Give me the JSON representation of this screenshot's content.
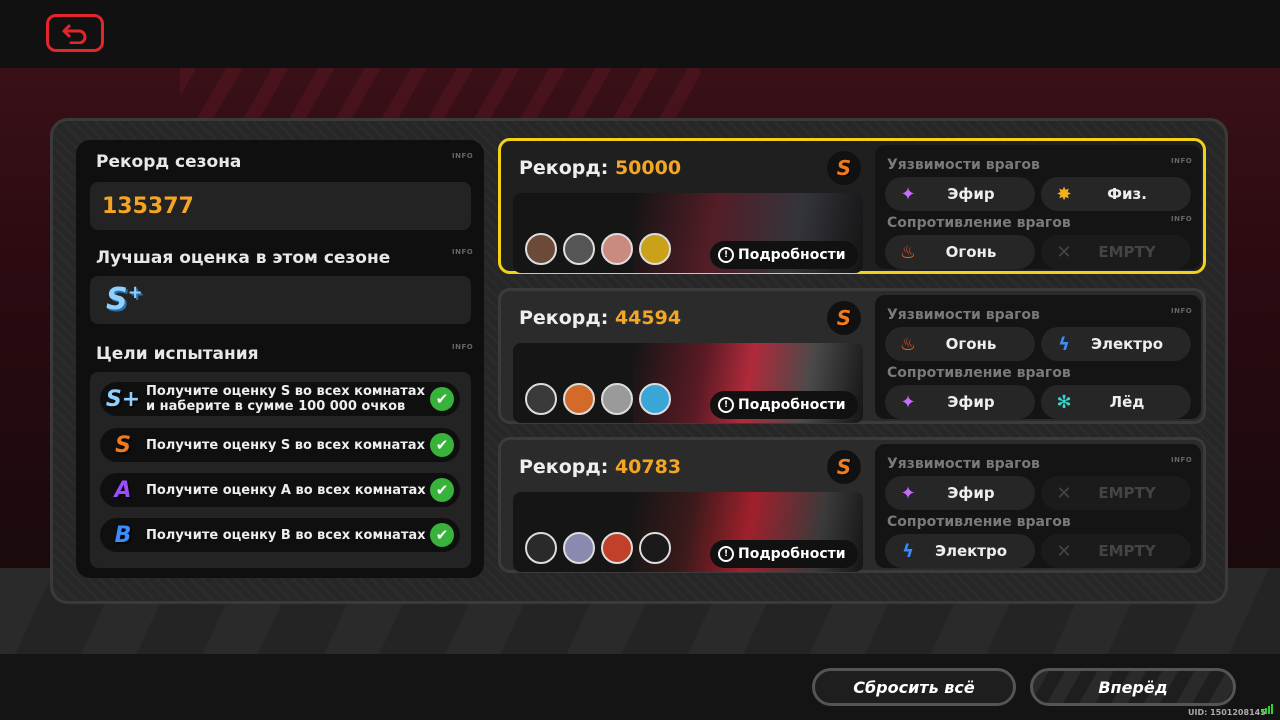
{
  "colors": {
    "accent": "#f5a524",
    "active_border": "#f2d11b",
    "back": "#e3262b",
    "check": "#37b23a"
  },
  "left": {
    "season_record_title": "Рекорд сезона",
    "info": "INFO",
    "season_record_value": "135377",
    "best_grade_title": "Лучшая оценка в этом сезоне",
    "best_grade": "S",
    "best_grade_plus": "+",
    "goals_title": "Цели испытания",
    "goals": [
      {
        "grade": "S+",
        "text": "Получите оценку S во всех комнатах и наберите в сумме 100 000 очков",
        "done": true,
        "color": "#8fd0ff"
      },
      {
        "grade": "S",
        "text": "Получите оценку S во всех комнатах",
        "done": true,
        "color": "#f07a1e"
      },
      {
        "grade": "A",
        "text": "Получите оценку A во всех комнатах",
        "done": true,
        "color": "#9b4dff"
      },
      {
        "grade": "B",
        "text": "Получите оценку B во всех комнатах",
        "done": true,
        "color": "#3b8cff"
      }
    ]
  },
  "rooms": [
    {
      "record_label": "Рекорд:",
      "record": "50000",
      "grade": "S",
      "details": "Подробности",
      "weak_label": "Уязвимости врагов",
      "resist_label": "Сопротивление врагов",
      "info": "INFO",
      "weak": [
        {
          "icon": "ether-icon",
          "name": "Эфир"
        },
        {
          "icon": "physical-icon",
          "name": "Физ."
        }
      ],
      "resist": [
        {
          "icon": "fire-icon",
          "name": "Огонь"
        },
        {
          "icon": "empty-icon",
          "name": "EMPTY"
        }
      ]
    },
    {
      "record_label": "Рекорд:",
      "record": "44594",
      "grade": "S",
      "details": "Подробности",
      "weak_label": "Уязвимости врагов",
      "resist_label": "Сопротивление врагов",
      "info": "INFO",
      "weak": [
        {
          "icon": "fire-icon",
          "name": "Огонь"
        },
        {
          "icon": "electric-icon",
          "name": "Электро"
        }
      ],
      "resist": [
        {
          "icon": "ether-icon",
          "name": "Эфир"
        },
        {
          "icon": "ice-icon",
          "name": "Лёд"
        }
      ]
    },
    {
      "record_label": "Рекорд:",
      "record": "40783",
      "grade": "S",
      "details": "Подробности",
      "weak_label": "Уязвимости врагов",
      "resist_label": "Сопротивление врагов",
      "info": "INFO",
      "weak": [
        {
          "icon": "ether-icon",
          "name": "Эфир"
        },
        {
          "icon": "empty-icon",
          "name": "EMPTY"
        }
      ],
      "resist": [
        {
          "icon": "electric-icon",
          "name": "Электро"
        },
        {
          "icon": "empty-icon",
          "name": "EMPTY"
        }
      ]
    }
  ],
  "buttons": {
    "reset": "Сбросить всё",
    "forward": "Вперёд"
  },
  "uid": "UID: 1501208145"
}
